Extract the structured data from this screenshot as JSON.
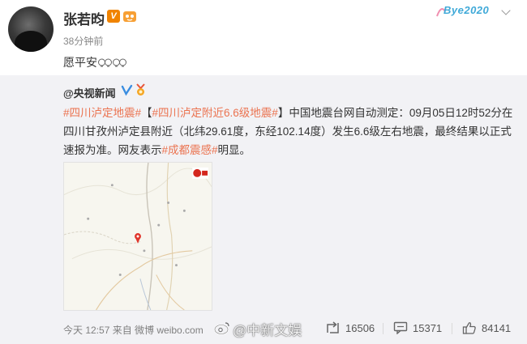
{
  "post": {
    "author": "张若昀",
    "time": "38分钟前",
    "text": "愿平安",
    "emoji_icons": [
      "pray-icon",
      "pray-icon"
    ],
    "collect_label": "Bye2020"
  },
  "repost": {
    "source": "@央视新闻",
    "tag1": "#四川泸定地震#",
    "tag2_prefix": "【",
    "tag2": "#四川泸定附近6.6级地震#",
    "text_part1": "】中国地震台网自动测定：09月05日12时52分在四川甘孜州泸定县附近（北纬29.61度，东经102.14度）发生6.6级左右地震，最终结果以正式速报为准。网友表示",
    "tag3": "#成都震感#",
    "text_part2": "明显。",
    "image_icon": "map-icon"
  },
  "footer": {
    "meta": "今天 12:57 来自 微博 weibo.com",
    "repost_count": "16506",
    "comment_count": "15371",
    "like_count": "84141",
    "watermark": "@中新文娱"
  },
  "colors": {
    "tag": "#eb7350",
    "repost_bg": "#f2f2f5",
    "verified_orange": "#f08300",
    "verified_blue": "#3a8de0"
  }
}
